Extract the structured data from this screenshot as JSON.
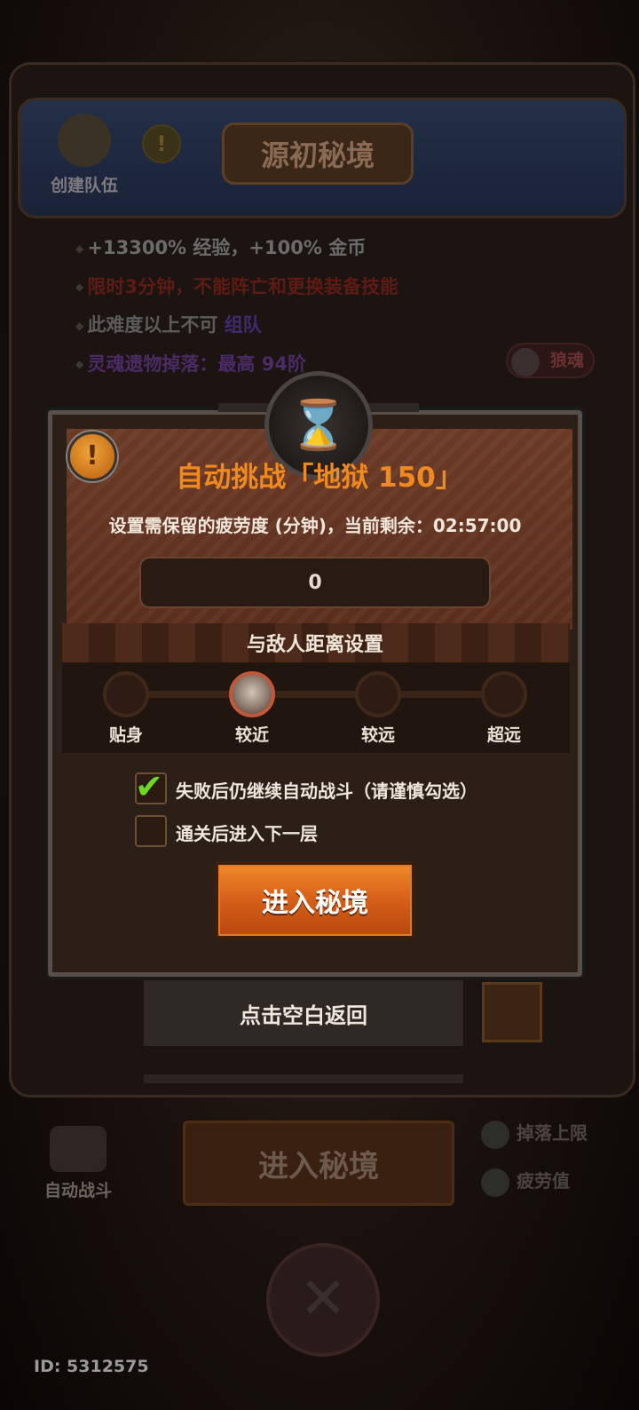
{
  "background": {
    "create_team_label": "创建队伍",
    "title": "源初秘境",
    "bullets": {
      "b1": "+13300% 经验，+100% 金币",
      "b2": "限时3分钟，不能阵亡和更换装备技能",
      "b3_prefix": "此难度以上不可",
      "b3_highlight": "组队",
      "b4": "灵魂遗物掉落：最高 94阶"
    },
    "soul_badge": "狼魂",
    "tap_back": "点击空白返回",
    "auto_battle_label": "自动战斗",
    "enter_button": "进入秘境",
    "drop_limit_label": "掉落上限",
    "fatigue_label": "疲劳值",
    "user_id": "ID: 5312575"
  },
  "dialog": {
    "title": "自动挑战「地狱 150」",
    "subtitle": "设置需保留的疲劳度 (分钟)，当前剩余：02:57:00",
    "fatigue_value": "0",
    "distance_title": "与敌人距离设置",
    "distance_options": [
      "贴身",
      "较近",
      "较远",
      "超远"
    ],
    "distance_selected": "较近",
    "checkbox_continue": {
      "label": "失败后仍继续自动战斗（请谨慎勾选）",
      "checked": true
    },
    "checkbox_next_floor": {
      "label": "通关后进入下一层",
      "checked": false
    },
    "enter_button": "进入秘境"
  }
}
